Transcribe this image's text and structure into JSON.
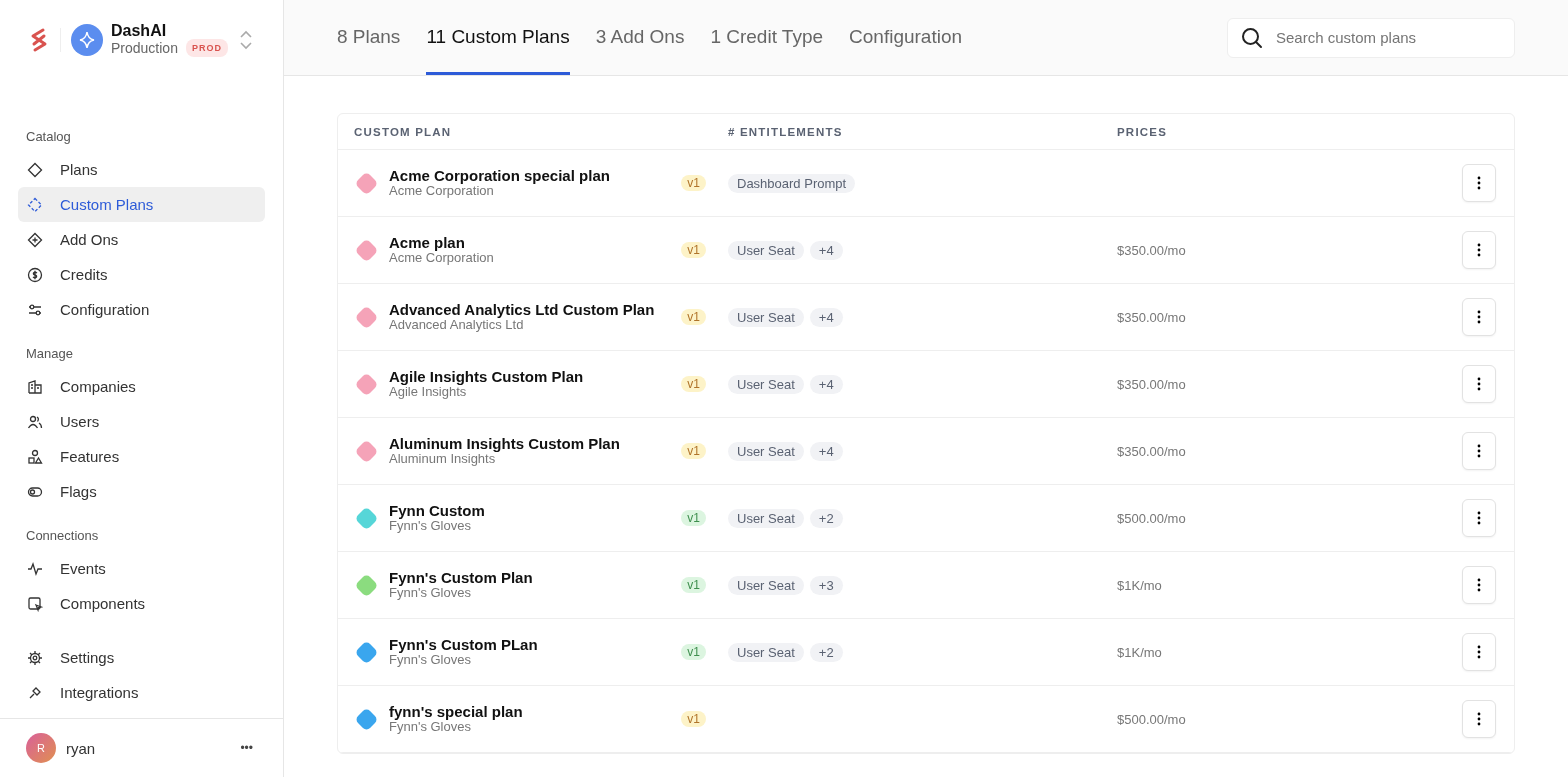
{
  "org": {
    "name": "DashAI",
    "environment": "Production",
    "badge": "PROD"
  },
  "sidebar": {
    "sections": [
      {
        "title": "Catalog",
        "items": [
          {
            "label": "Plans",
            "selected": false
          },
          {
            "label": "Custom Plans",
            "selected": true
          },
          {
            "label": "Add Ons",
            "selected": false
          },
          {
            "label": "Credits",
            "selected": false
          },
          {
            "label": "Configuration",
            "selected": false
          }
        ]
      },
      {
        "title": "Manage",
        "items": [
          {
            "label": "Companies",
            "selected": false
          },
          {
            "label": "Users",
            "selected": false
          },
          {
            "label": "Features",
            "selected": false
          },
          {
            "label": "Flags",
            "selected": false
          }
        ]
      },
      {
        "title": "Connections",
        "items": [
          {
            "label": "Events",
            "selected": false
          },
          {
            "label": "Components",
            "selected": false
          }
        ]
      },
      {
        "items": [
          {
            "label": "Settings",
            "selected": false
          },
          {
            "label": "Integrations",
            "selected": false
          }
        ]
      }
    ]
  },
  "user": {
    "initial": "R",
    "name": "ryan",
    "menu": "•••"
  },
  "tabs": [
    {
      "label": "8 Plans",
      "selected": false
    },
    {
      "label": "11 Custom Plans",
      "selected": true
    },
    {
      "label": "3 Add Ons",
      "selected": false
    },
    {
      "label": "1 Credit Type",
      "selected": false
    },
    {
      "label": "Configuration",
      "selected": false
    }
  ],
  "search": {
    "placeholder": "Search custom plans"
  },
  "table": {
    "columns": [
      "CUSTOM PLAN",
      "# ENTITLEMENTS",
      "PRICES"
    ],
    "rows": [
      {
        "name": "Acme Corporation special plan",
        "company": "Acme Corporation",
        "color": "#f5a3b8",
        "version": {
          "label": "v1",
          "color": "#fdf3c8"
        },
        "entitlements": [
          "Dashboard Prompt"
        ],
        "price": ""
      },
      {
        "name": "Acme plan",
        "company": "Acme Corporation",
        "color": "#f5a3b8",
        "version": {
          "label": "v1",
          "color": "#fdf3c8"
        },
        "entitlements": [
          "User Seat",
          "+4"
        ],
        "price": "$350.00/mo"
      },
      {
        "name": "Advanced Analytics Ltd Custom Plan",
        "company": "Advanced Analytics Ltd",
        "color": "#f5a3b8",
        "version": {
          "label": "v1",
          "color": "#fdf3c8"
        },
        "entitlements": [
          "User Seat",
          "+4"
        ],
        "price": "$350.00/mo"
      },
      {
        "name": "Agile Insights Custom Plan",
        "company": "Agile Insights",
        "color": "#f5a3b8",
        "version": {
          "label": "v1",
          "color": "#fdf3c8"
        },
        "entitlements": [
          "User Seat",
          "+4"
        ],
        "price": "$350.00/mo"
      },
      {
        "name": "Aluminum Insights Custom Plan",
        "company": "Aluminum Insights",
        "color": "#f5a3b8",
        "version": {
          "label": "v1",
          "color": "#fdf3c8"
        },
        "entitlements": [
          "User Seat",
          "+4"
        ],
        "price": "$350.00/mo"
      },
      {
        "name": "Fynn Custom",
        "company": "Fynn's Gloves",
        "color": "#56d6d8",
        "version": {
          "label": "v1",
          "color": "#dcf5e0"
        },
        "entitlements": [
          "User Seat",
          "+2"
        ],
        "price": "$500.00/mo"
      },
      {
        "name": "Fynn's Custom Plan",
        "company": "Fynn's Gloves",
        "color": "#8bdc7f",
        "version": {
          "label": "v1",
          "color": "#dcf5e0"
        },
        "entitlements": [
          "User Seat",
          "+3"
        ],
        "price": "$1K/mo"
      },
      {
        "name": "Fynn's Custom PLan",
        "company": "Fynn's Gloves",
        "color": "#3aa6ee",
        "version": {
          "label": "v1",
          "color": "#dcf5e0"
        },
        "entitlements": [
          "User Seat",
          "+2"
        ],
        "price": "$1K/mo"
      },
      {
        "name": "fynn's special plan",
        "company": "Fynn's Gloves",
        "color": "#3aa6ee",
        "version": {
          "label": "v1",
          "color": "#fdf3c8"
        },
        "entitlements": [],
        "price": "$500.00/mo"
      }
    ]
  }
}
